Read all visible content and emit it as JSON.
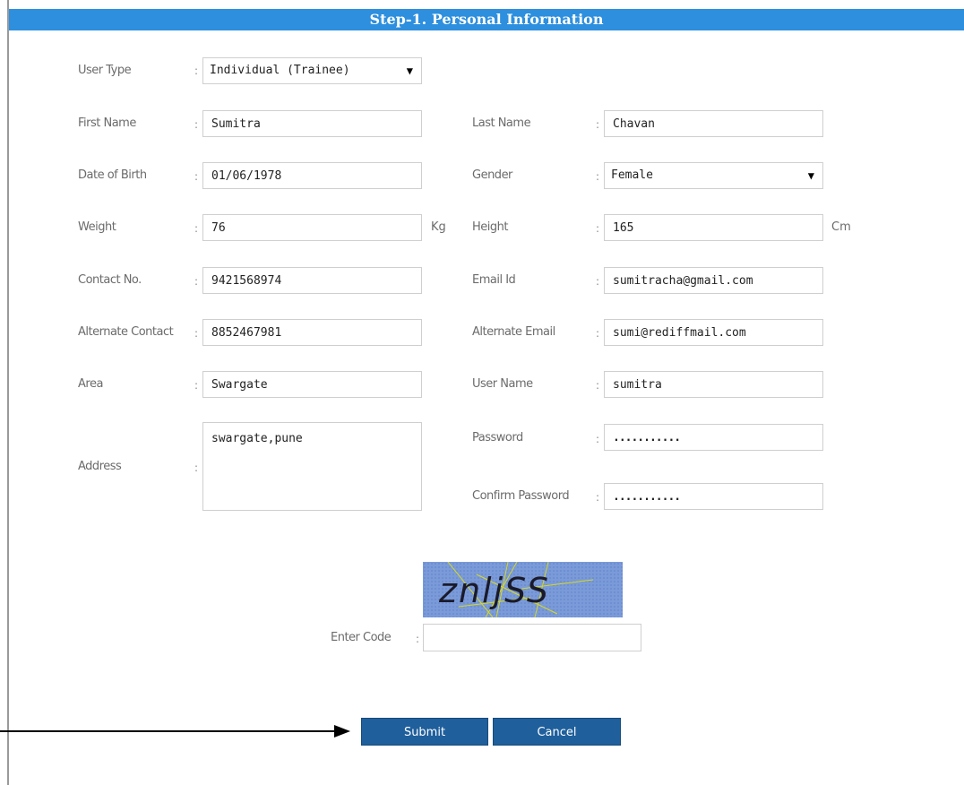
{
  "header": {
    "title": "Step-1. Personal Information"
  },
  "form": {
    "user_type": {
      "label": "User Type",
      "value": "Individual (Trainee)"
    },
    "first_name": {
      "label": "First Name",
      "value": "Sumitra"
    },
    "last_name": {
      "label": "Last Name",
      "value": "Chavan"
    },
    "dob": {
      "label": "Date of Birth",
      "value": "01/06/1978"
    },
    "gender": {
      "label": "Gender",
      "value": "Female"
    },
    "weight": {
      "label": "Weight",
      "value": "76",
      "unit": "Kg"
    },
    "height": {
      "label": "Height",
      "value": "165",
      "unit": "Cm"
    },
    "contact": {
      "label": "Contact No.",
      "value": "9421568974"
    },
    "email": {
      "label": "Email Id",
      "value": "sumitracha@gmail.com"
    },
    "alt_contact": {
      "label": "Alternate Contact",
      "value": "8852467981"
    },
    "alt_email": {
      "label": "Alternate Email",
      "value": "sumi@rediffmail.com"
    },
    "area": {
      "label": "Area",
      "value": "Swargate"
    },
    "username": {
      "label": "User Name",
      "value": "sumitra"
    },
    "address": {
      "label": "Address",
      "value": "swargate,pune"
    },
    "password": {
      "label": "Password",
      "value": "..........."
    },
    "confirm_password": {
      "label": "Confirm Password",
      "value": "..........."
    },
    "captcha": {
      "text": "znljSS",
      "code_label": "Enter Code",
      "code_value": ""
    },
    "colon": ":"
  },
  "buttons": {
    "submit": "Submit",
    "cancel": "Cancel"
  },
  "colors": {
    "header_bg": "#2d8fde",
    "button_bg": "#1f5f9c",
    "captcha_bg": "#7a9ad8"
  },
  "icons": {
    "dropdown": "triangle-down-icon",
    "annotation": "arrow-right-icon"
  }
}
